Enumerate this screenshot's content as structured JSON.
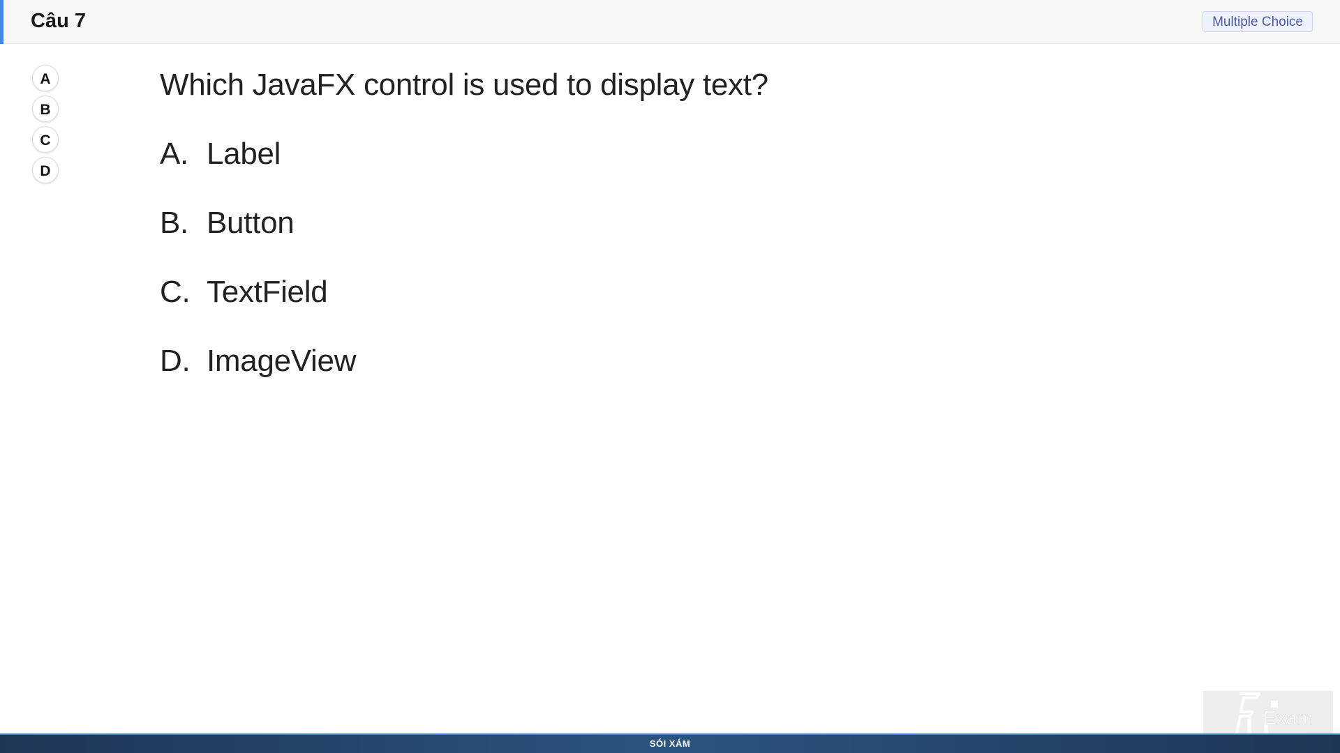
{
  "header": {
    "title": "Câu 7",
    "type_badge": "Multiple Choice",
    "accent_color": "#4a86e8"
  },
  "answer_selector": {
    "choices": [
      "A",
      "B",
      "C",
      "D"
    ]
  },
  "question": {
    "text": "Which JavaFX control is used to display text?",
    "options": [
      {
        "letter": "A.",
        "text": "Label"
      },
      {
        "letter": "B.",
        "text": "Button"
      },
      {
        "letter": "C.",
        "text": "TextField"
      },
      {
        "letter": "D.",
        "text": "ImageView"
      }
    ]
  },
  "footer": {
    "text": "SÓI XÁM"
  },
  "watermark": {
    "icon": "fu-exam-logo-icon",
    "text": "Exam"
  }
}
